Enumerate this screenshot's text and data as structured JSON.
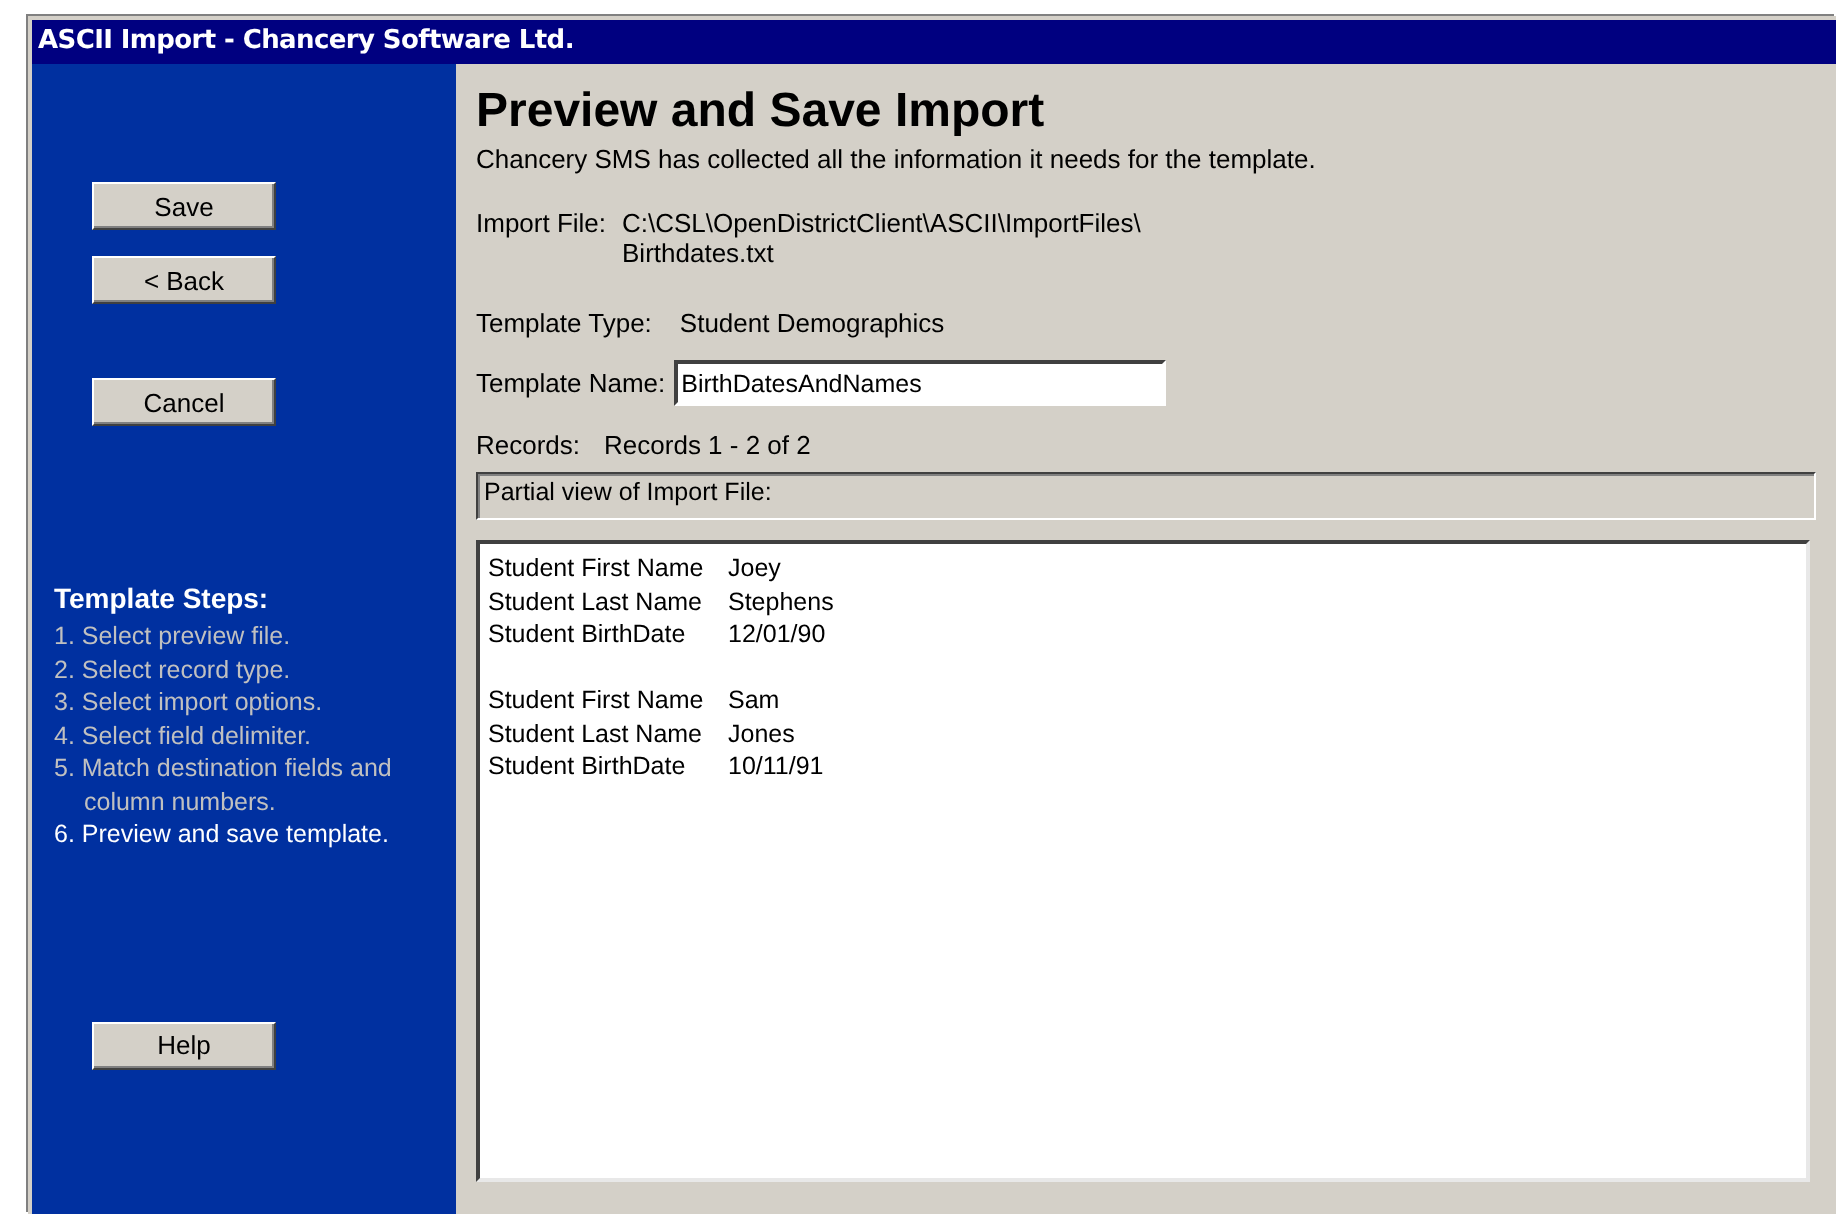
{
  "window": {
    "title": "ASCII Import - Chancery Software Ltd."
  },
  "nav_buttons": [
    {
      "label": "Save"
    },
    {
      "label": "< Back"
    },
    {
      "label": "Cancel"
    }
  ],
  "steps": {
    "title": "Template Steps:",
    "items": [
      {
        "text": "1. Select preview file.",
        "current": false
      },
      {
        "text": "2. Select record type.",
        "current": false
      },
      {
        "text": "3. Select import options.",
        "current": false
      },
      {
        "text": "4. Select field delimiter.",
        "current": false
      },
      {
        "text": "5. Match destination fields and column numbers.",
        "current": false
      },
      {
        "text": "6. Preview and save template.",
        "current": true
      }
    ]
  },
  "help_button": {
    "label": "Help"
  },
  "heading": "Preview and Save Import",
  "intro": "Chancery SMS has collected all the information it needs for the template.",
  "import_file": {
    "label": "Import File:",
    "path": "C:\\CSL\\OpenDistrictClient\\ASCII\\ImportFiles\\",
    "file": "Birthdates.txt"
  },
  "template_type": {
    "label": "Template Type:",
    "value": "Student Demographics"
  },
  "template_name": {
    "label": "Template Name:",
    "value": "BirthDatesAndNames"
  },
  "records": {
    "label": "Records:",
    "value": "Records 1 - 2 of 2"
  },
  "preview": {
    "title": "Partial view of Import File:",
    "records": [
      [
        {
          "field": "Student First Name",
          "value": "Joey"
        },
        {
          "field": "Student Last Name",
          "value": "Stephens"
        },
        {
          "field": "Student BirthDate",
          "value": "12/01/90"
        }
      ],
      [
        {
          "field": "Student First Name",
          "value": "Sam"
        },
        {
          "field": "Student Last Name",
          "value": "Jones"
        },
        {
          "field": "Student BirthDate",
          "value": "10/11/91"
        }
      ]
    ]
  }
}
